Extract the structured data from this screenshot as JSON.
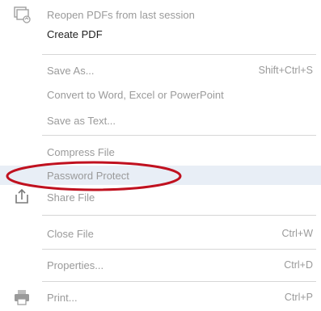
{
  "menu": {
    "reopen": {
      "label": "Reopen PDFs from last session"
    },
    "create_pdf": {
      "label": "Create PDF"
    },
    "save_as": {
      "label": "Save As...",
      "shortcut": "Shift+Ctrl+S"
    },
    "convert": {
      "label": "Convert to Word, Excel or PowerPoint"
    },
    "save_as_text": {
      "label": "Save as Text..."
    },
    "compress": {
      "label": "Compress File"
    },
    "password_protect": {
      "label": "Password Protect"
    },
    "share_file": {
      "label": "Share File"
    },
    "close_file": {
      "label": "Close File",
      "shortcut": "Ctrl+W"
    },
    "properties": {
      "label": "Properties...",
      "shortcut": "Ctrl+D"
    },
    "print": {
      "label": "Print...",
      "shortcut": "Ctrl+P"
    }
  },
  "colors": {
    "annotation_ellipse": "#c0111f",
    "disabled_text": "#9a9a9a",
    "hover_background": "#e8eef6"
  }
}
